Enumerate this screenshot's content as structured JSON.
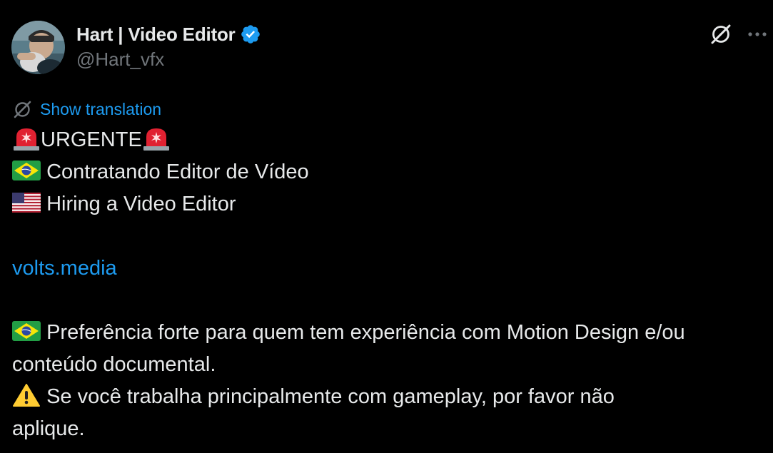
{
  "author": {
    "display_name": "Hart | Video Editor",
    "handle": "@Hart_vfx",
    "verified": true
  },
  "actions": {
    "grok_icon": "grok-icon",
    "more_icon": "more-icon"
  },
  "translation": {
    "label": "Show translation"
  },
  "body": {
    "urgent": "URGENTE",
    "pt_hiring": "Contratando Editor de Vídeo",
    "en_hiring": "Hiring a Video Editor",
    "link": "volts.media",
    "pref_line1": "Preferência forte para quem tem experiência com Motion Design e/ou",
    "pref_line2": "conteúdo documental.",
    "warn_line1": "Se você trabalha principalmente com gameplay, por favor não",
    "warn_line2": "aplique."
  },
  "icons": {
    "siren": "police-light-icon",
    "brazil_flag": "brazil-flag-icon",
    "us_flag": "us-flag-icon",
    "warning": "warning-icon"
  },
  "colors": {
    "background": "#000000",
    "text": "#e7e9ea",
    "secondary": "#71767b",
    "link": "#1d9bf0",
    "verified": "#1d9bf0"
  }
}
